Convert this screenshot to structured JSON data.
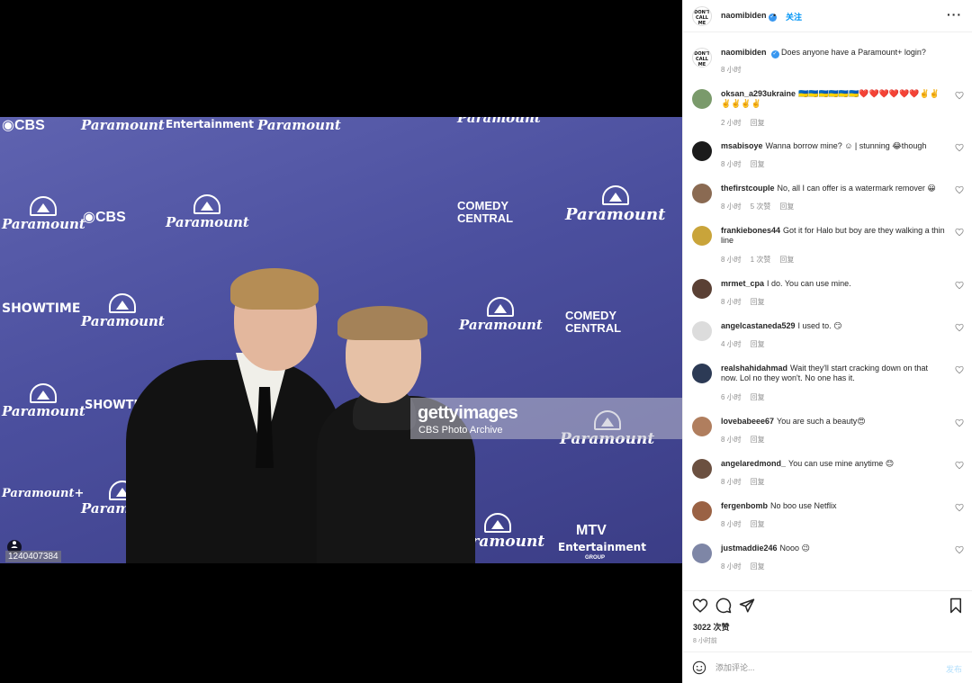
{
  "post": {
    "username": "naomibiden",
    "follow_label": "关注",
    "separator": "•",
    "more_label": "···",
    "avatar_text": "DON'T CALL ME BABY"
  },
  "photo": {
    "watermark_brand": "gettyimages",
    "watermark_credit": "CBS Photo Archive",
    "photo_id": "1240407384",
    "wall_labels": {
      "paramount": "Paramount",
      "paramount_plus": "Paramount+",
      "cbs": "◉CBS",
      "showtime": "SHOWTIME",
      "comedy_central": "COMEDY CENTRAL",
      "entertainment": "Entertainment",
      "group": "GROUP",
      "mtv": "MTV"
    }
  },
  "caption": {
    "username": "naomibiden",
    "text": "Does anyone have a Paramount+ login?",
    "time": "8 小时"
  },
  "reply_label": "回复",
  "comments": [
    {
      "username": "oksan_a293ukraine",
      "text": "🇺🇦🇺🇦🇺🇦🇺🇦🇺🇦🇺🇦❤️❤️❤️❤️❤️❤️✌️✌️✌️✌️✌️✌️",
      "time": "2 小时",
      "likes": "",
      "avatar_color": "#7a9a6b"
    },
    {
      "username": "msabisoye",
      "text": "Wanna borrow mine? ☺ | stunning 😂though",
      "time": "8 小时",
      "likes": "",
      "avatar_color": "#1b1b1b"
    },
    {
      "username": "thefirstcouple",
      "text": "No, all I can offer is a watermark remover 😀",
      "time": "8 小时",
      "likes": "5 次赞",
      "avatar_color": "#8a6a52"
    },
    {
      "username": "frankiebones44",
      "text": "Got it for Halo but boy are they walking a thin line",
      "time": "8 小时",
      "likes": "1 次赞",
      "avatar_color": "#c9a43a"
    },
    {
      "username": "mrmet_cpa",
      "text": "I do. You can use mine.",
      "time": "8 小时",
      "likes": "",
      "avatar_color": "#5a4034"
    },
    {
      "username": "angelcastaneda529",
      "text": "I used to. 😏",
      "time": "4 小时",
      "likes": "",
      "avatar_color": "#dcdcdc"
    },
    {
      "username": "realshahidahmad",
      "text": "Wait they'll start cracking down on that now. Lol no they won't. No one has it.",
      "time": "6 小时",
      "likes": "",
      "avatar_color": "#2c3a55"
    },
    {
      "username": "lovebabeee67",
      "text": "You are such a beauty😍",
      "time": "8 小时",
      "likes": "",
      "avatar_color": "#b07e5e"
    },
    {
      "username": "angelaredmond_",
      "text": "You can use mine anytime 😊",
      "time": "8 小时",
      "likes": "",
      "avatar_color": "#6b5040"
    },
    {
      "username": "fergenbomb",
      "text": "No boo use Netflix",
      "time": "8 小时",
      "likes": "",
      "avatar_color": "#9a6244"
    },
    {
      "username": "justmaddie246",
      "text": "Nooo 😉",
      "time": "8 小时",
      "likes": "",
      "avatar_color": "#7e86a6"
    }
  ],
  "footer": {
    "likes_count": "3022 次赞",
    "posted_time": "8 小时前",
    "comment_placeholder": "添加评论...",
    "post_label": "发布"
  },
  "colors": {
    "accent": "#0095f6",
    "muted": "#8e8e8e",
    "backdrop": "#4b4f9e"
  },
  "icons": [
    "heart-icon",
    "comment-icon",
    "share-icon",
    "bookmark-icon",
    "emoji-icon",
    "verified-icon",
    "user-tag-icon",
    "more-icon"
  ]
}
